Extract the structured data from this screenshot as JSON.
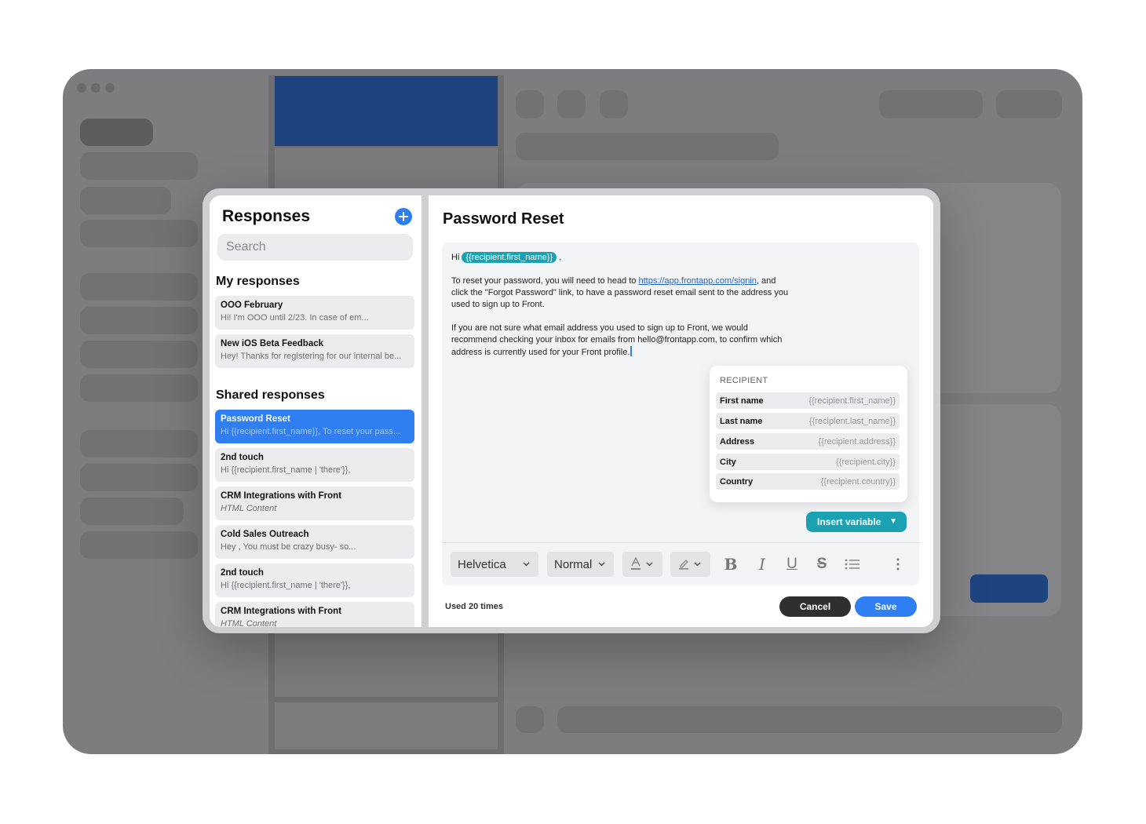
{
  "left": {
    "title": "Responses",
    "search_placeholder": "Search",
    "my_section": "My responses",
    "shared_section": "Shared responses",
    "my_items": [
      {
        "title": "OOO February",
        "snippet": "Hi! I'm OOO until  2/23. In case of em..."
      },
      {
        "title": "New iOS Beta Feedback",
        "snippet": "Hey! Thanks for registering for our internal be..."
      }
    ],
    "shared_items": [
      {
        "title": "Password Reset",
        "snippet": "Hi {{recipient.first_name}}, To reset your pass..."
      },
      {
        "title": "2nd touch",
        "snippet": "Hi {{recipient.first_name | 'there'}},"
      },
      {
        "title": "CRM Integrations with Front",
        "snippet": "HTML Content"
      },
      {
        "title": "Cold Sales Outreach",
        "snippet": "Hey , You must be crazy busy- so..."
      },
      {
        "title": "2nd touch",
        "snippet": "Hi {{recipient.first_name | 'there'}},"
      },
      {
        "title": "CRM Integrations with Front",
        "snippet": "HTML Content"
      }
    ]
  },
  "editor": {
    "title": "Password Reset",
    "greeting": "Hi",
    "greeting_var": "{{recipient.first_name}}",
    "greeting_end": ",",
    "p1_line1_a": "To reset your password, you will need to head to ",
    "p1_link": "https://app.frontapp.com/signin",
    "p1_line1_b": ", and",
    "p1_line2": "click the \"Forgot Password\" link, to have a password reset email sent to the address you",
    "p1_line3": "used to sign up to Front.",
    "p2_line1": "If you are not sure what email address you used to sign up to Front, we would",
    "p2_line2": "recommend checking your inbox for emails from hello@frontapp.com, to confirm which",
    "p2_line3": "address is currently used for your Front profile."
  },
  "variables": {
    "header": "RECIPIENT",
    "rows": [
      {
        "label": "First name",
        "value": "{{recipient.first_name}}"
      },
      {
        "label": "Last name",
        "value": "{{recipient.last_name}}"
      },
      {
        "label": "Address",
        "value": "{{recipient.address}}"
      },
      {
        "label": "City",
        "value": "{{recipient.city}}"
      },
      {
        "label": "Country",
        "value": "{{recipient.country}}"
      }
    ],
    "insert_label": "Insert variable"
  },
  "toolbar": {
    "font": "Helvetica",
    "size": "Normal"
  },
  "footer": {
    "usage": "Used 20 times",
    "cancel": "Cancel",
    "save": "Save"
  },
  "colors": {
    "accent": "#2f7ef2",
    "variable": "#1aa2b3",
    "background_app": "#7d7d7f"
  }
}
